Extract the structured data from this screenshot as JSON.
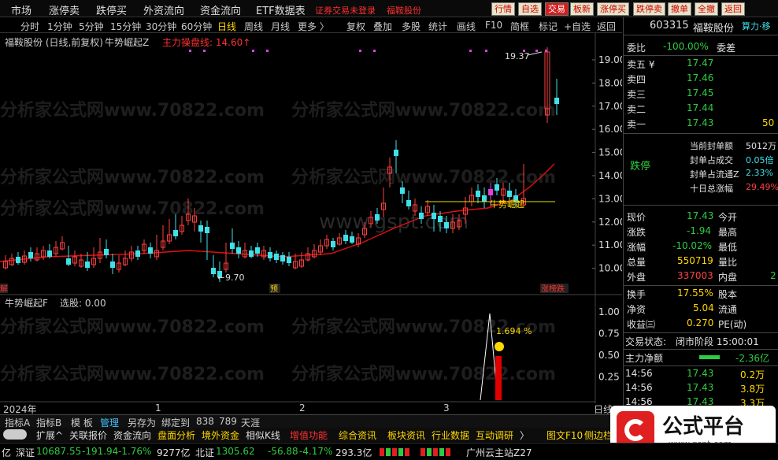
{
  "menu": {
    "items": [
      "市场",
      "涨停卖",
      "跌停买",
      "外资流向",
      "资金流向",
      "ETF数据表"
    ],
    "trade_status": "证券交易未登录",
    "stock_name_red": "福鞍股份",
    "buttons": [
      "行情",
      "自选",
      "交易",
      "板新",
      "涨停买",
      "跌停卖",
      "撤单",
      "全撤",
      "返回"
    ]
  },
  "periods": [
    "分时",
    "1分钟",
    "5分钟",
    "15分钟",
    "30分钟",
    "60分钟",
    "日线",
    "周线",
    "月线",
    "更多 〉"
  ],
  "active_period": "日线",
  "chart_tools": [
    "复权",
    "叠加",
    "多股",
    "统计",
    "画线",
    "F10",
    "简框",
    "标记",
    "+自选",
    "返回"
  ],
  "chart": {
    "title": "福鞍股份 (日线,前复权)",
    "indicator": "牛势崛起Z",
    "indicator_line": "主力操盘线: 14.60↑",
    "y_ticks": [
      "19.00",
      "18.00",
      "17.00",
      "16.00",
      "15.00",
      "14.00",
      "13.00",
      "12.00",
      "11.00",
      "10.00"
    ],
    "high_label": "19.37",
    "low_label": "9.70",
    "signal_label": "牛势崛起",
    "marker_left": "解",
    "marker_yu": "预",
    "marker_right": "涨榜跌",
    "watermark": "分析家公式网www.70822.com",
    "watermark2": "www.gspt.com"
  },
  "sub_chart": {
    "title": "牛势崛起F",
    "select_label": "选股: 0.00",
    "y_ticks": [
      "1.00",
      "0.75",
      "0.50",
      "0.25"
    ],
    "pct_label": "1.694 %"
  },
  "x_axis": [
    "2024年",
    "1",
    "2",
    "3"
  ],
  "x_axis_right": "日线",
  "bottom_tabs": [
    "指标A",
    "指标B",
    "模 板",
    "管理",
    "另存为",
    "绑定到",
    "838",
    "789",
    "天涯"
  ],
  "bottom_tabs_active": "管理",
  "tabs2": [
    "扩展^",
    "关联报价",
    "资金流向",
    "盘面分析",
    "境外资金",
    "相似K线",
    "增值功能",
    "综合资讯",
    "板块资讯",
    "行业数据",
    "互动调研",
    "〉"
  ],
  "tabs2_right": [
    "图文F10",
    "侧边栏"
  ],
  "quote": {
    "code": "603315",
    "name": "福鞍股份",
    "tool_label": "算力·移",
    "webi_label": "委比",
    "webi": "-100.00%",
    "weicha_label": "委差",
    "asks": [
      {
        "label": "卖五 ¥",
        "price": "17.47"
      },
      {
        "label": "卖四",
        "price": "17.46"
      },
      {
        "label": "卖三",
        "price": "17.45"
      },
      {
        "label": "卖二",
        "price": "17.44"
      },
      {
        "label": "卖一",
        "price": "17.43",
        "vol": "50"
      }
    ],
    "limit_status": "跌停",
    "limit_rows": [
      {
        "label": "当前封单额",
        "value": "5012万"
      },
      {
        "label": "封单占成交",
        "value": "0.05倍"
      },
      {
        "label": "封单占流通Z",
        "value": "2.33%"
      },
      {
        "label": "十日总涨幅",
        "value": "29.49%"
      }
    ],
    "stats": [
      {
        "l1": "现价",
        "v1": "17.43",
        "l2": "今开",
        "v2": ""
      },
      {
        "l1": "涨跌",
        "v1": "-1.94",
        "l2": "最高",
        "v2": ""
      },
      {
        "l1": "涨幅",
        "v1": "-10.02%",
        "l2": "最低",
        "v2": ""
      },
      {
        "l1": "总量",
        "v1": "550719",
        "l2": "量比",
        "v2": ""
      },
      {
        "l1": "外盘",
        "v1": "337003",
        "l2": "内盘",
        "v2": "2"
      }
    ],
    "stats2": [
      {
        "l1": "换手",
        "v1": "17.55%",
        "l2": "股本"
      },
      {
        "l1": "净资",
        "v1": "5.04",
        "l2": "流通"
      },
      {
        "l1": "收益㈢",
        "v1": "0.270",
        "l2": "PE(动)"
      }
    ],
    "trade_state_label": "交易状态:",
    "trade_state": "闭市阶段 15:00:01",
    "net_label": "主力净额",
    "net_value": "-2.36亿",
    "ticks": [
      {
        "time": "14:56",
        "price": "17.43",
        "vol": "0.2万"
      },
      {
        "time": "14:56",
        "price": "17.43",
        "vol": "3.8万"
      },
      {
        "time": "14:56",
        "price": "17.43",
        "vol": "3.3万"
      }
    ]
  },
  "status_bar": {
    "prefix": "亿",
    "sz_label": "深证",
    "sz_value": "10687.55",
    "sz_change": "-191.94",
    "sz_pct": "-1.76%",
    "sz_amount": "9277亿",
    "bz_label": "北证",
    "bz_value": "1305.62",
    "bz_change": "-56.88",
    "bz_pct": "-4.17%",
    "bz_amount": "293.3亿",
    "server": "广州云主站Z27"
  },
  "logo_text": "公式平台",
  "logo_url": "www.gspt.com"
}
